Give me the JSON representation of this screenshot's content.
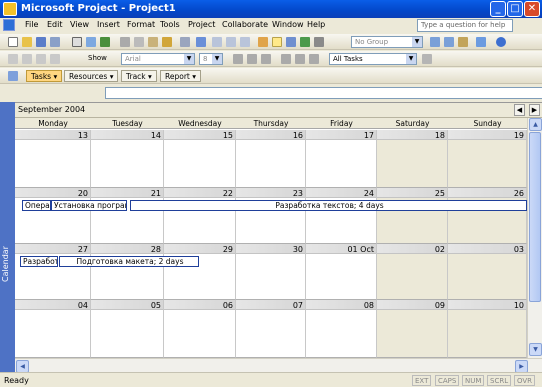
{
  "window": {
    "title": "Microsoft Project - Project1"
  },
  "menu": {
    "items": [
      "File",
      "Edit",
      "View",
      "Insert",
      "Format",
      "Tools",
      "Project",
      "Collaborate",
      "Window",
      "Help"
    ],
    "help_placeholder": "Type a question for help"
  },
  "toolbar": {
    "group_combo": "No Group",
    "font_combo": "Arial",
    "size_combo": "8",
    "show_label": "Show",
    "filter_combo": "All Tasks"
  },
  "guide": {
    "tasks": "Tasks",
    "resources": "Resources",
    "track": "Track",
    "report": "Report"
  },
  "view": {
    "sidebar_label": "Calendar"
  },
  "calendar": {
    "month_label": "September 2004",
    "days": [
      "Monday",
      "Tuesday",
      "Wednesday",
      "Thursday",
      "Friday",
      "Saturday",
      "Sunday"
    ],
    "weeks": [
      [
        "13",
        "14",
        "15",
        "16",
        "17",
        "18",
        "19"
      ],
      [
        "20",
        "21",
        "22",
        "23",
        "24",
        "25",
        "26"
      ],
      [
        "27",
        "28",
        "29",
        "30",
        "01 Oct",
        "02",
        "03"
      ],
      [
        "04",
        "05",
        "06",
        "07",
        "08",
        "09",
        "10"
      ]
    ],
    "tasks": [
      {
        "label": "Опера"
      },
      {
        "label": "Установка программ"
      },
      {
        "label": "Разработка текстов; 4 days"
      },
      {
        "label": "Разработ"
      },
      {
        "label": "Подготовка макета; 2 days"
      }
    ]
  },
  "status": {
    "text": "Ready",
    "indicators": [
      "EXT",
      "CAPS",
      "NUM",
      "SCRL",
      "OVR"
    ]
  }
}
